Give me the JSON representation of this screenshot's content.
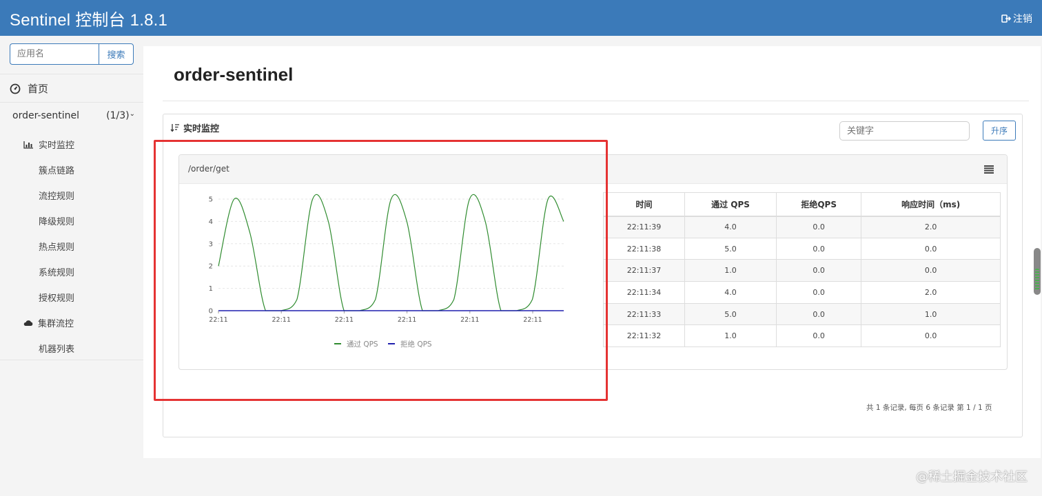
{
  "header": {
    "title": "Sentinel 控制台 1.8.1",
    "logout_label": "注销"
  },
  "sidebar": {
    "search_placeholder": "应用名",
    "search_button": "搜索",
    "home_label": "首页",
    "app": {
      "name": "order-sentinel",
      "count": "(1/3)"
    },
    "items": [
      {
        "label": "实时监控",
        "icon": "bar-chart-icon"
      },
      {
        "label": "簇点链路"
      },
      {
        "label": "流控规则"
      },
      {
        "label": "降级规则"
      },
      {
        "label": "热点规则"
      },
      {
        "label": "系统规则"
      },
      {
        "label": "授权规则"
      },
      {
        "label": "集群流控",
        "icon": "cloud-icon"
      },
      {
        "label": "机器列表"
      }
    ]
  },
  "main": {
    "page_title": "order-sentinel",
    "panel_title": "实时监控",
    "keyword_placeholder": "关键字",
    "sort_button": "升序",
    "resource": "/order/get",
    "table": {
      "headers": [
        "时间",
        "通过 QPS",
        "拒绝QPS",
        "响应时间（ms)"
      ],
      "rows": [
        [
          "22:11:39",
          "4.0",
          "0.0",
          "2.0"
        ],
        [
          "22:11:38",
          "5.0",
          "0.0",
          "0.0"
        ],
        [
          "22:11:37",
          "1.0",
          "0.0",
          "0.0"
        ],
        [
          "22:11:34",
          "4.0",
          "0.0",
          "2.0"
        ],
        [
          "22:11:33",
          "5.0",
          "0.0",
          "1.0"
        ],
        [
          "22:11:32",
          "1.0",
          "0.0",
          "0.0"
        ]
      ]
    },
    "pagination": "共 1 条记录, 每页 6 条记录 第 1 / 1 页"
  },
  "chart_data": {
    "type": "line",
    "x": [
      "22:11",
      "22:11",
      "22:11",
      "22:11",
      "22:11",
      "22:11"
    ],
    "ylim": [
      0,
      5
    ],
    "yticks": [
      0,
      1,
      2,
      3,
      4,
      5
    ],
    "series": [
      {
        "name": "通过 QPS",
        "color": "#2e8b2e",
        "values": [
          2,
          5,
          3.5,
          0,
          0,
          0.5,
          5,
          4,
          0,
          0,
          0.5,
          5,
          4,
          0,
          0,
          0.5,
          5,
          4,
          0,
          0,
          0.5,
          5,
          4
        ]
      },
      {
        "name": "拒绝 QPS",
        "color": "#1f1fae",
        "values": [
          0,
          0,
          0,
          0,
          0,
          0,
          0,
          0,
          0,
          0,
          0,
          0,
          0,
          0,
          0,
          0,
          0,
          0,
          0,
          0,
          0,
          0,
          0
        ]
      }
    ],
    "legend": "bottom"
  },
  "colors": {
    "brand": "#3b7ab9",
    "highlight": "#e53333"
  },
  "watermark": "@稀土掘金技术社区"
}
